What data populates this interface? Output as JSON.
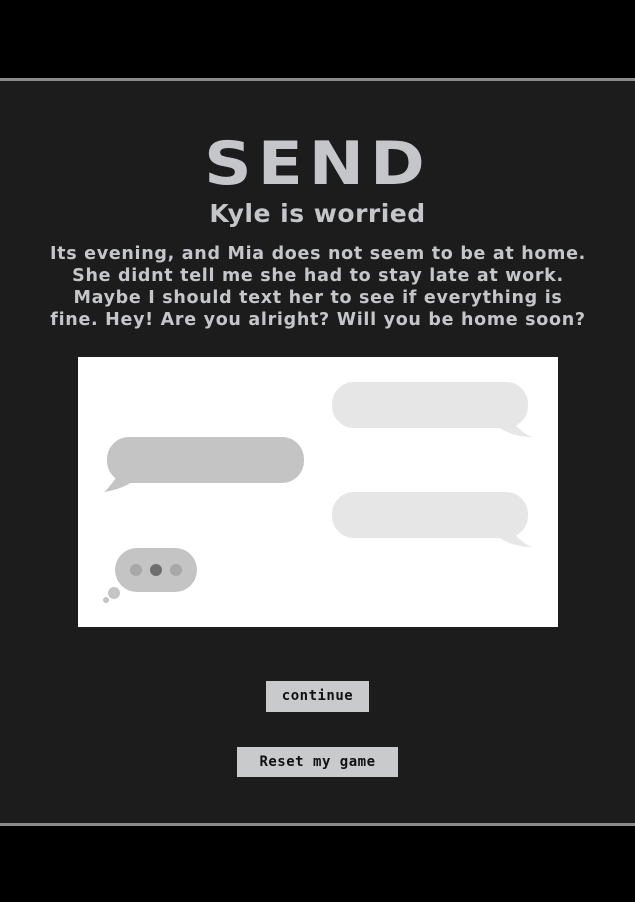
{
  "game": {
    "logo_text": "SEND",
    "subtitle": "Kyle is worried",
    "story_lines": [
      "Its evening, and Mia does not seem to be at home.",
      "She didnt tell me she had to stay late at work.",
      "Maybe I should text her to see if everything is",
      "fine. Hey! Are you alright? Will you be home soon?"
    ]
  },
  "buttons": {
    "continue_label": "continue",
    "reset_label": "Reset my game"
  },
  "colors": {
    "background": "#000000",
    "panel": "#1c1c1c",
    "text": "#c4c6c9",
    "button": "#c8cacc",
    "bubble_incoming": "#c4c4c4",
    "bubble_outgoing": "#e6e6e6"
  }
}
